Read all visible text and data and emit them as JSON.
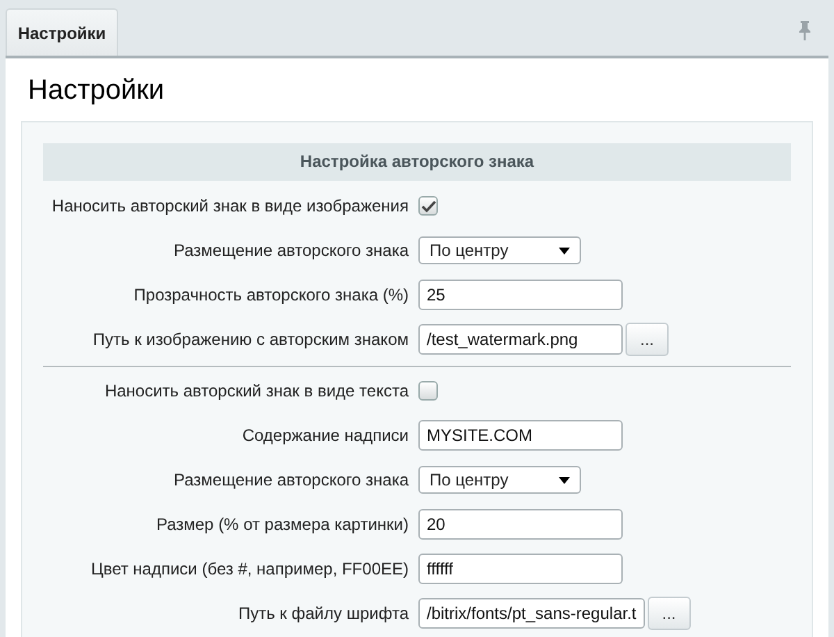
{
  "tabs": [
    {
      "label": "Настройки",
      "selected": true
    }
  ],
  "page_title": "Настройки",
  "section_title": "Настройка авторского знака",
  "groups": [
    {
      "rows": [
        {
          "kind": "checkbox",
          "label": "Наносить авторский знак в виде изображения",
          "checked": true
        },
        {
          "kind": "select",
          "label": "Размещение авторского знака",
          "value": "По центру"
        },
        {
          "kind": "input",
          "label": "Прозрачность авторского знака (%)",
          "value": "25"
        },
        {
          "kind": "file",
          "label": "Путь к изображению с авторским знаком",
          "value": "/test_watermark.png",
          "button": "..."
        }
      ]
    },
    {
      "rows": [
        {
          "kind": "checkbox",
          "label": "Наносить авторский знак в виде текста",
          "checked": false
        },
        {
          "kind": "input",
          "label": "Содержание надписи",
          "value": "MYSITE.COM"
        },
        {
          "kind": "select",
          "label": "Размещение авторского знака",
          "value": "По центру"
        },
        {
          "kind": "input",
          "label": "Размер (% от размера картинки)",
          "value": "20"
        },
        {
          "kind": "input",
          "label": "Цвет надписи (без #, например, FF00EE)",
          "value": "ffffff"
        },
        {
          "kind": "file",
          "label": "Путь к файлу шрифта",
          "value": "/bitrix/fonts/pt_sans-regular.t",
          "button": "..."
        }
      ]
    }
  ]
}
